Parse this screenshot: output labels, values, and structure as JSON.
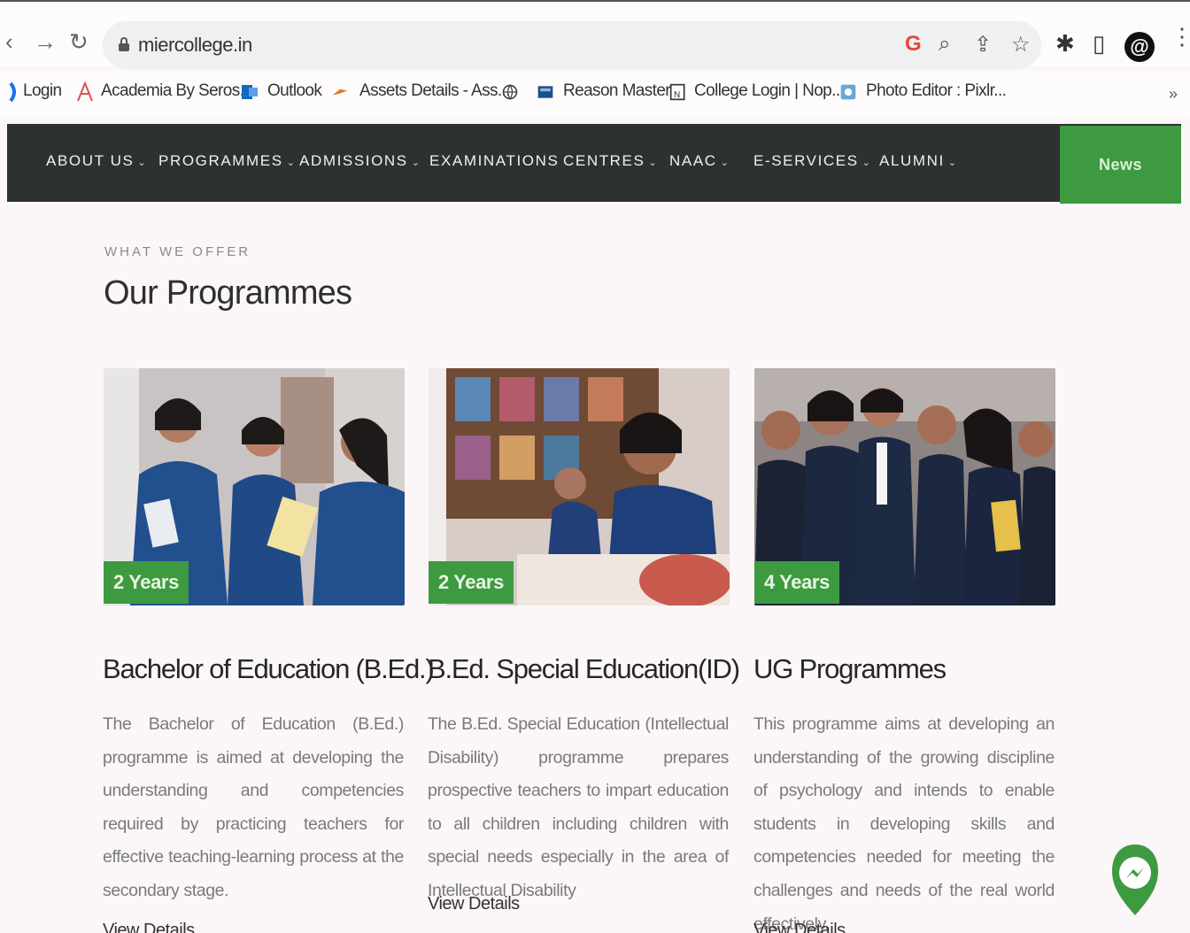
{
  "browser": {
    "url": "miercollege.in",
    "bookmarks": [
      {
        "label": "Login",
        "icon": "bookmark-icon"
      },
      {
        "label": "Academia By Seros...",
        "icon": "academia-icon"
      },
      {
        "label": "Outlook",
        "icon": "outlook-icon"
      },
      {
        "label": "Assets Details - Ass...",
        "icon": "assets-icon"
      },
      {
        "label": "",
        "icon": "globe-icon"
      },
      {
        "label": "Reason Master",
        "icon": "reason-icon"
      },
      {
        "label": "College Login | Nop...",
        "icon": "college-icon"
      },
      {
        "label": "Photo Editor : Pixlr...",
        "icon": "pixlr-icon"
      }
    ],
    "profile_initial": "@"
  },
  "nav": {
    "items": [
      {
        "label": "ABOUT US",
        "dropdown": true
      },
      {
        "label": "PROGRAMMES",
        "dropdown": true
      },
      {
        "label": "ADMISSIONS",
        "dropdown": true
      },
      {
        "label": "EXAMINATIONS",
        "dropdown": false
      },
      {
        "label": "CENTRES",
        "dropdown": true
      },
      {
        "label": "NAAC",
        "dropdown": true
      },
      {
        "label": "E-SERVICES",
        "dropdown": true
      },
      {
        "label": "ALUMNI",
        "dropdown": true
      }
    ],
    "news_label": "News",
    "accent": "#3e9a40",
    "bar_color": "#2d3231"
  },
  "section": {
    "eyebrow": "WHAT WE OFFER",
    "title": "Our Programmes"
  },
  "programmes": [
    {
      "duration": "2 Years",
      "title": "Bachelor of Education (B.Ed.)",
      "description": "The Bachelor of Education (B.Ed.) programme is aimed at developing the understanding and competencies required by practicing teachers for effective teaching-learning process at the secondary stage.",
      "link": "View Details"
    },
    {
      "duration": "2 Years",
      "title": "B.Ed. Special Education(ID)",
      "description": "The B.Ed. Special Education (Intellectual Disability) programme prepares prospective teachers to impart education to all children including children with special needs especially in the area of Intellectual Disability",
      "link": "View Details"
    },
    {
      "duration": "4 Years",
      "title": "UG Programmes",
      "description": "This programme aims at developing an understanding of the growing discipline of psychology and intends to enable students in developing skills and competencies needed for meeting the challenges and needs of the real world effectively.",
      "link": "View Details"
    }
  ]
}
